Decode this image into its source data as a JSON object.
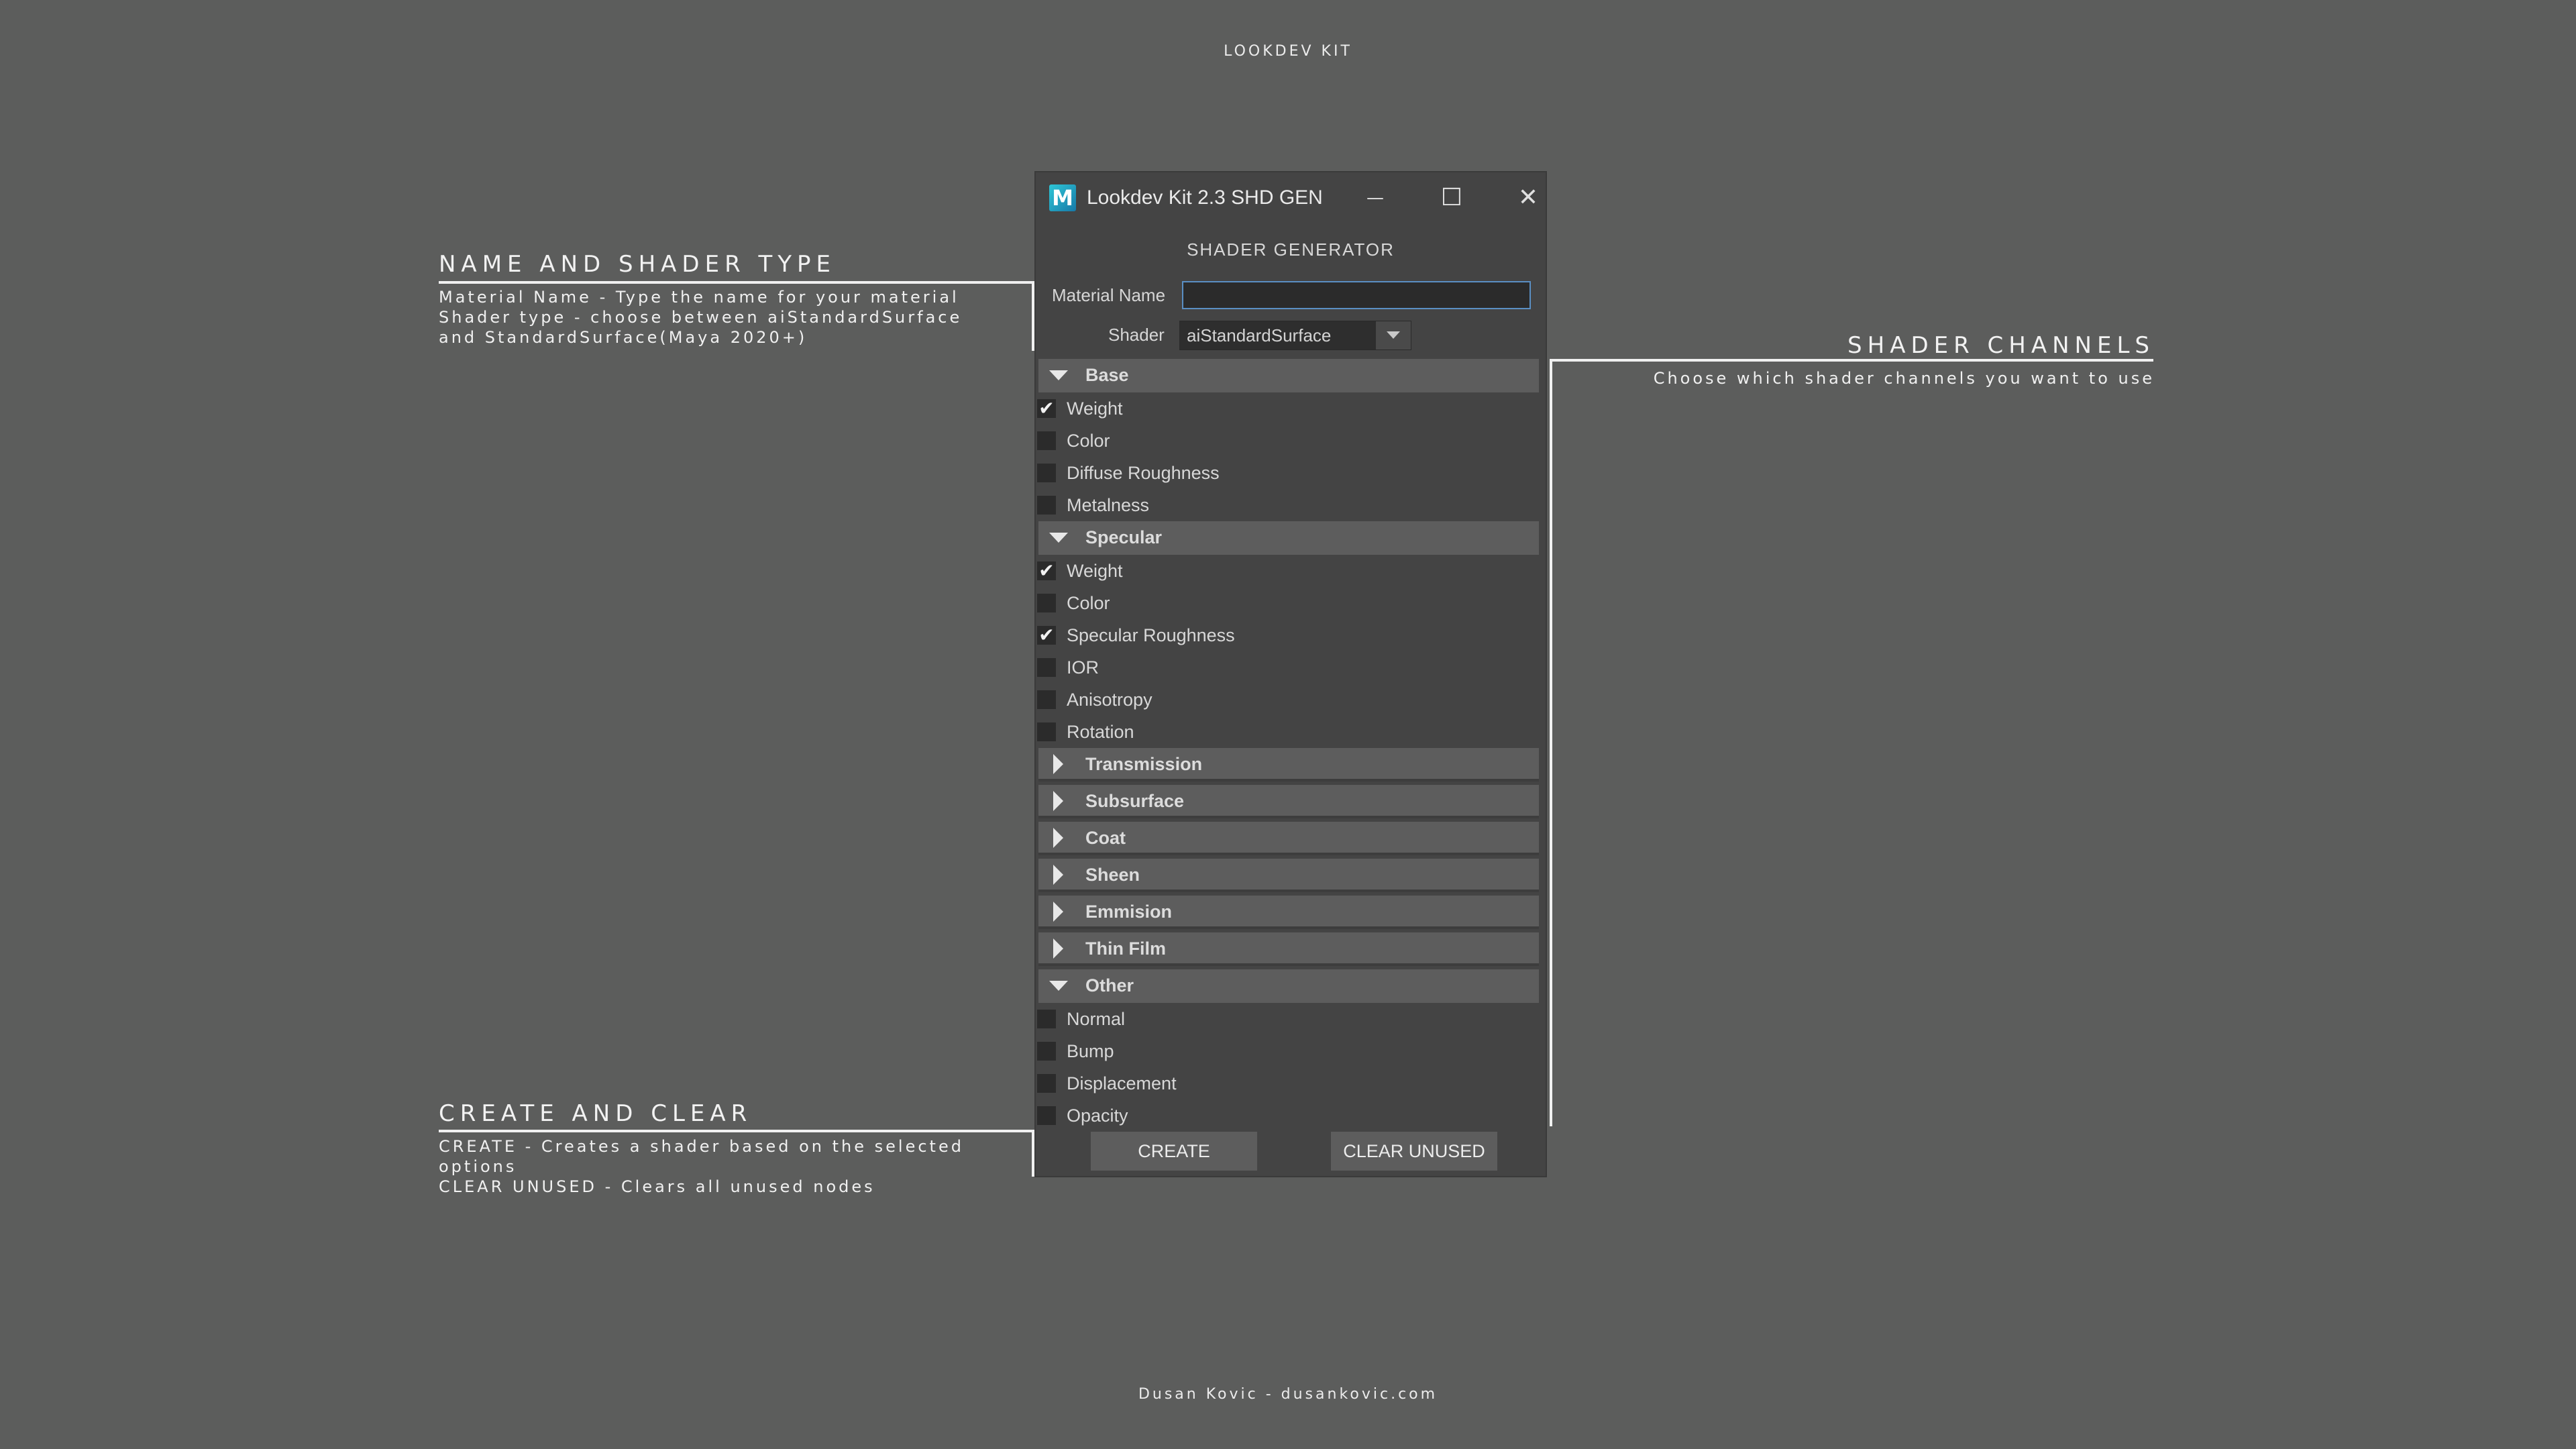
{
  "page": {
    "title": "LOOKDEV KIT",
    "footer": "Dusan Kovic - dusankovic.com"
  },
  "annotations": {
    "name_shader": {
      "title": "NAME AND SHADER TYPE",
      "lines": [
        "Material Name - Type the name for your material",
        "Shader type - choose between aiStandardSurface",
        "and StandardSurface(Maya 2020+)"
      ]
    },
    "shader_channels": {
      "title": "SHADER CHANNELS",
      "lines": [
        "Choose which shader channels you want to use"
      ]
    },
    "create_clear": {
      "title": "CREATE AND CLEAR",
      "lines": [
        "CREATE - Creates a shader based on the selected",
        "options",
        "CLEAR UNUSED - Clears all unused nodes"
      ]
    }
  },
  "window": {
    "title": "Lookdev Kit 2.3 SHD GEN",
    "icon_letter": "M",
    "controls": {
      "minimize": "—",
      "maximize": "☐",
      "close": "✕"
    },
    "heading": "SHADER  GENERATOR",
    "material_name_label": "Material Name",
    "material_name_value": "",
    "shader_label": "Shader",
    "shader_value": "aiStandardSurface",
    "sections": [
      {
        "label": "Base",
        "expanded": true,
        "items": [
          {
            "label": "Weight",
            "checked": true
          },
          {
            "label": "Color",
            "checked": false
          },
          {
            "label": "Diffuse Roughness",
            "checked": false
          },
          {
            "label": "Metalness",
            "checked": false
          }
        ]
      },
      {
        "label": "Specular",
        "expanded": true,
        "items": [
          {
            "label": "Weight",
            "checked": true
          },
          {
            "label": "Color",
            "checked": false
          },
          {
            "label": "Specular Roughness",
            "checked": true
          },
          {
            "label": "IOR",
            "checked": false
          },
          {
            "label": "Anisotropy",
            "checked": false
          },
          {
            "label": "Rotation",
            "checked": false
          }
        ]
      },
      {
        "label": "Transmission",
        "expanded": false,
        "items": []
      },
      {
        "label": "Subsurface",
        "expanded": false,
        "items": []
      },
      {
        "label": "Coat",
        "expanded": false,
        "items": []
      },
      {
        "label": "Sheen",
        "expanded": false,
        "items": []
      },
      {
        "label": "Emmision",
        "expanded": false,
        "items": []
      },
      {
        "label": "Thin Film",
        "expanded": false,
        "items": []
      },
      {
        "label": "Other",
        "expanded": true,
        "items": [
          {
            "label": "Normal",
            "checked": false
          },
          {
            "label": "Bump",
            "checked": false
          },
          {
            "label": "Displacement",
            "checked": false
          },
          {
            "label": "Opacity",
            "checked": false
          }
        ]
      }
    ],
    "buttons": {
      "create": "CREATE",
      "clear": "CLEAR UNUSED"
    }
  },
  "colors": {
    "background": "#5c5d5c",
    "window": "#444444",
    "section_header": "#5d5d5d",
    "input_focus": "#5a8fc4",
    "icon_accent": "#2ec6d6"
  }
}
